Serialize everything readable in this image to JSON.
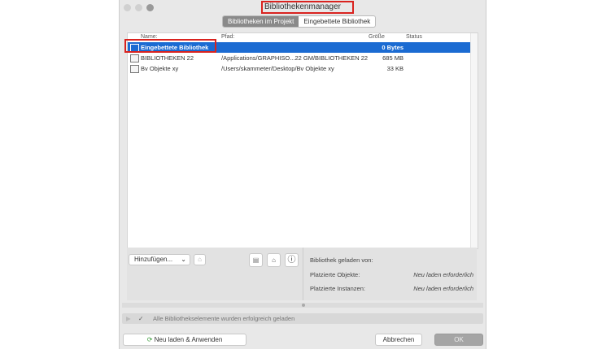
{
  "window": {
    "title": "Bibliothekenmanager"
  },
  "tabs": [
    {
      "label": "Bibliotheken im Projekt",
      "active": true
    },
    {
      "label": "Eingebettete Bibliothek",
      "active": false
    }
  ],
  "table": {
    "columns": [
      "Name:",
      "Pfad:",
      "Größe",
      "Status"
    ],
    "rows": [
      {
        "name": "Eingebettete Bibliothek",
        "path": "",
        "size": "0 Bytes",
        "status": "",
        "selected": true,
        "icon": "embedded-library-icon"
      },
      {
        "name": "BIBLIOTHEKEN 22",
        "path": "/Applications/GRAPHISO...22 GM/BIBLIOTHEKEN 22",
        "size": "685 MB",
        "status": "",
        "icon": "library-folder-icon"
      },
      {
        "name": "Bv Objekte xy",
        "path": "/Users/skammeter/Desktop/Bv Objekte xy",
        "size": "33 KB",
        "status": "",
        "icon": "library-folder-icon"
      }
    ]
  },
  "panel": {
    "add_label": "Hinzufügen...",
    "loaded_from_label": "Bibliothek geladen von:",
    "placed_objects_label": "Platzierte Objekte:",
    "placed_objects_value": "Neu laden erforderlich",
    "placed_instances_label": "Platzierte Instanzen:",
    "placed_instances_value": "Neu laden erforderlich"
  },
  "status": {
    "message": "Alle Bibliothekselemente wurden erfolgreich geladen"
  },
  "footer": {
    "reload_label": "Neu laden & Anwenden",
    "cancel_label": "Abbrechen",
    "ok_label": "OK"
  },
  "colors": {
    "selection": "#1b6bd2",
    "highlight": "#d9231f"
  }
}
